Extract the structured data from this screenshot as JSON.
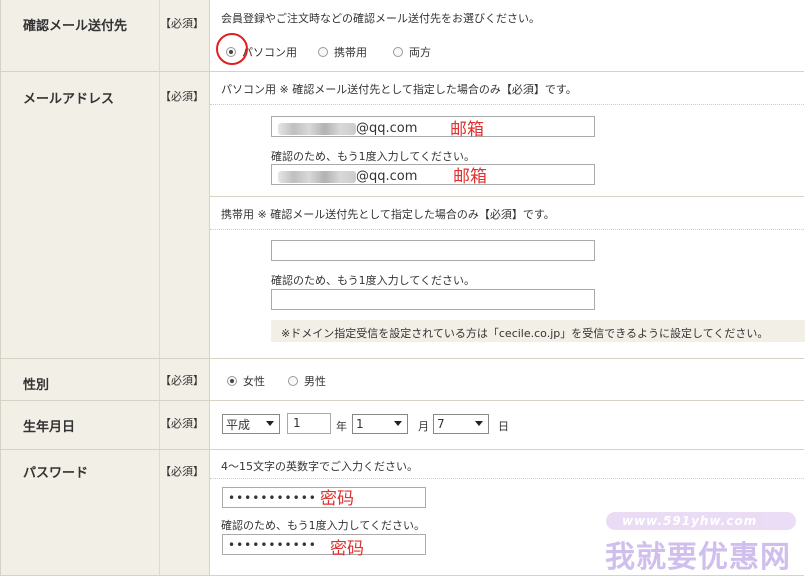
{
  "required_tag": "【必須】",
  "confirm_email": {
    "label": "確認メール送付先",
    "hint": "会員登録やご注文時などの確認メール送付先をお選びください。",
    "options": [
      "パソコン用",
      "携帯用",
      "両方"
    ],
    "selected": "パソコン用"
  },
  "email": {
    "label": "メールアドレス",
    "pc_note": "パソコン用 ※ 確認メール送付先として指定した場合のみ【必須】です。",
    "pc_value": "@qq.com",
    "pc_confirm_note": "確認のため、もう1度入力してください。",
    "pc_confirm_value": "@qq.com",
    "annotation": "邮箱",
    "mobile_note": "携帯用 ※ 確認メール送付先として指定した場合のみ【必須】です。",
    "mobile_confirm_note": "確認のため、もう1度入力してください。",
    "domain_notice": "※ドメイン指定受信を設定されている方は「cecile.co.jp」を受信できるように設定してください。"
  },
  "gender": {
    "label": "性別",
    "options": [
      "女性",
      "男性"
    ],
    "selected": "女性"
  },
  "birthday": {
    "label": "生年月日",
    "era": "平成",
    "year": "1",
    "year_unit": "年",
    "month": "1",
    "month_unit": "月",
    "day": "7",
    "day_unit": "日"
  },
  "password": {
    "label": "パスワード",
    "hint": "4～15文字の英数字でご入力ください。",
    "value": "•••••••••••",
    "confirm_note": "確認のため、もう1度入力してください。",
    "confirm_value": "•••••••••••",
    "annotation": "密码"
  },
  "watermark": {
    "url": "www.591yhw.com",
    "text": "我就要优惠网"
  }
}
